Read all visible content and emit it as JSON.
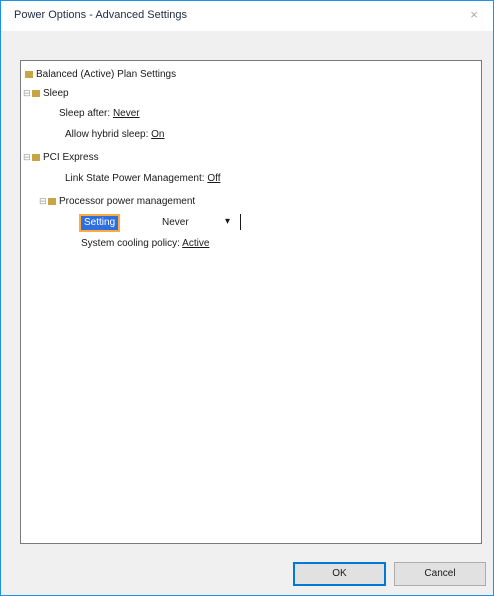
{
  "window": {
    "title": "Power Options - Advanced Settings",
    "close_glyph": "×"
  },
  "tree": {
    "root_label": "Balanced (Active) Plan Settings",
    "nodes": [
      {
        "label": "Sleep",
        "toggle": "⊟"
      },
      {
        "label": "Sleep after:",
        "value": "Never"
      },
      {
        "label": "Allow hybrid sleep:",
        "value": "On"
      },
      {
        "label": "PCI Express",
        "toggle": "⊟"
      },
      {
        "label": "Link State Power Management:",
        "value": "Off"
      },
      {
        "label": "Processor power management",
        "toggle": "⊟"
      },
      {
        "label": "Setting",
        "value": "Never"
      },
      {
        "label": "System cooling policy:",
        "value": "Active"
      }
    ]
  },
  "buttons": {
    "ok": "OK",
    "cancel": "Cancel"
  }
}
